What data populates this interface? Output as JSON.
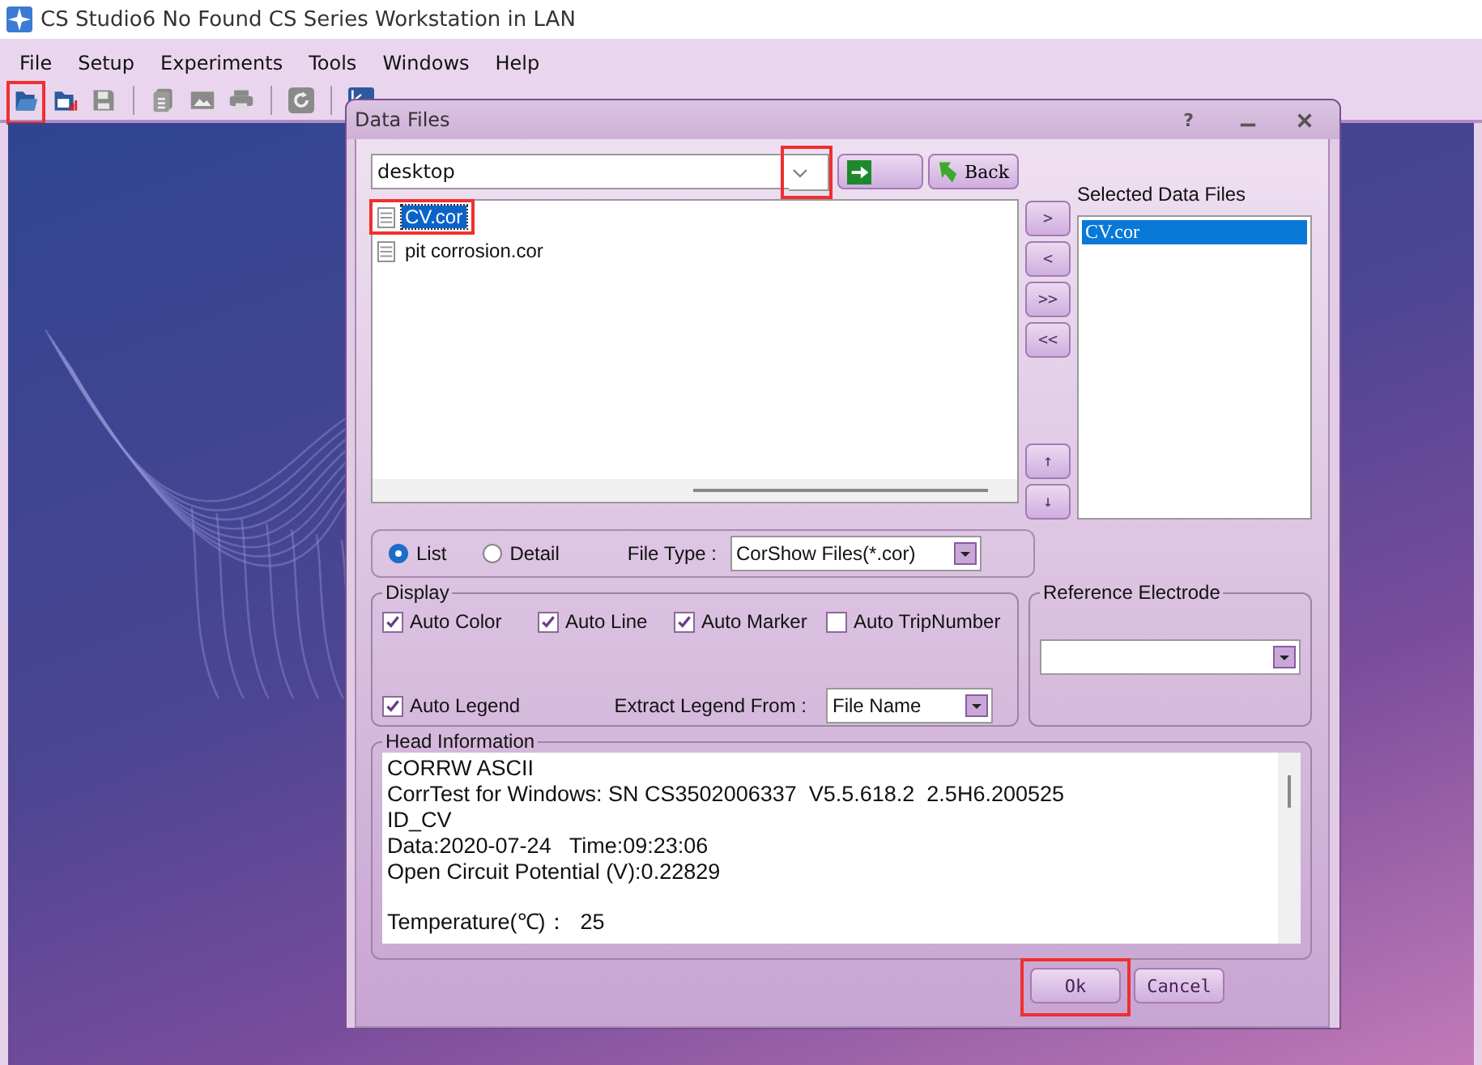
{
  "app": {
    "title": "CS Studio6   No Found CS Series Workstation in LAN"
  },
  "menu": [
    {
      "label": "File"
    },
    {
      "label": "Setup"
    },
    {
      "label": "Experiments"
    },
    {
      "label": "Tools"
    },
    {
      "label": "Windows"
    },
    {
      "label": "Help"
    }
  ],
  "toolbar": [
    {
      "kind": "open",
      "highlighted": true
    },
    {
      "kind": "recent",
      "highlighted": false
    },
    {
      "kind": "save",
      "highlighted": false
    },
    {
      "kind": "sep",
      "highlighted": false
    },
    {
      "kind": "copy",
      "highlighted": false
    },
    {
      "kind": "image",
      "highlighted": false
    },
    {
      "kind": "print",
      "highlighted": false
    },
    {
      "kind": "sep",
      "highlighted": false
    },
    {
      "kind": "refresh",
      "highlighted": false
    },
    {
      "kind": "sep",
      "highlighted": false
    },
    {
      "kind": "chart",
      "highlighted": false
    }
  ],
  "dialog": {
    "title": "Data Files",
    "help": "?",
    "path_combo": {
      "value": "desktop",
      "arrow_highlighted": true
    },
    "back_button": {
      "label": "Back"
    },
    "files": [
      {
        "name": "CV.cor",
        "selected": true,
        "highlighted": true
      },
      {
        "name": "pit corrosion.cor",
        "selected": false,
        "highlighted": false
      }
    ],
    "selected_files": {
      "label": "Selected Data Files",
      "items": [
        {
          "name": "CV.cor",
          "selected": true
        }
      ]
    },
    "move_buttons": [
      ">",
      "<",
      ">>",
      "<<",
      "↑",
      "↓"
    ],
    "view_mode": [
      {
        "label": "List",
        "selected": true
      },
      {
        "label": "Detail",
        "selected": false
      }
    ],
    "file_type": {
      "label": "File Type :",
      "value": "CorShow Files(*.cor)"
    },
    "display": {
      "title": "Display",
      "options": [
        {
          "label": "Auto Color",
          "checked": true
        },
        {
          "label": "Auto Line",
          "checked": true
        },
        {
          "label": "Auto Marker",
          "checked": true
        },
        {
          "label": "Auto TripNumber",
          "checked": false
        },
        {
          "label": "Auto Legend",
          "checked": true
        }
      ],
      "extract_legend": {
        "label": "Extract Legend From :",
        "value": "File Name"
      }
    },
    "reference_electrode": {
      "title": "Reference Electrode"
    },
    "head_info": {
      "title": "Head Information",
      "paragraphs": [
        [
          "CORRW ASCII",
          "CorrTest for Windows: SN CS3502006337  V5.5.618.2  2.5H6.200525",
          "ID_CV",
          "Data:2020-07-24   Time:09:23:06",
          "Open Circuit Potential (V):0.22829"
        ],
        [
          "Temperature(℃)：  25"
        ]
      ]
    },
    "buttons": [
      {
        "label": "Ok",
        "highlighted": true
      },
      {
        "label": "Cancel",
        "highlighted": false
      }
    ]
  }
}
